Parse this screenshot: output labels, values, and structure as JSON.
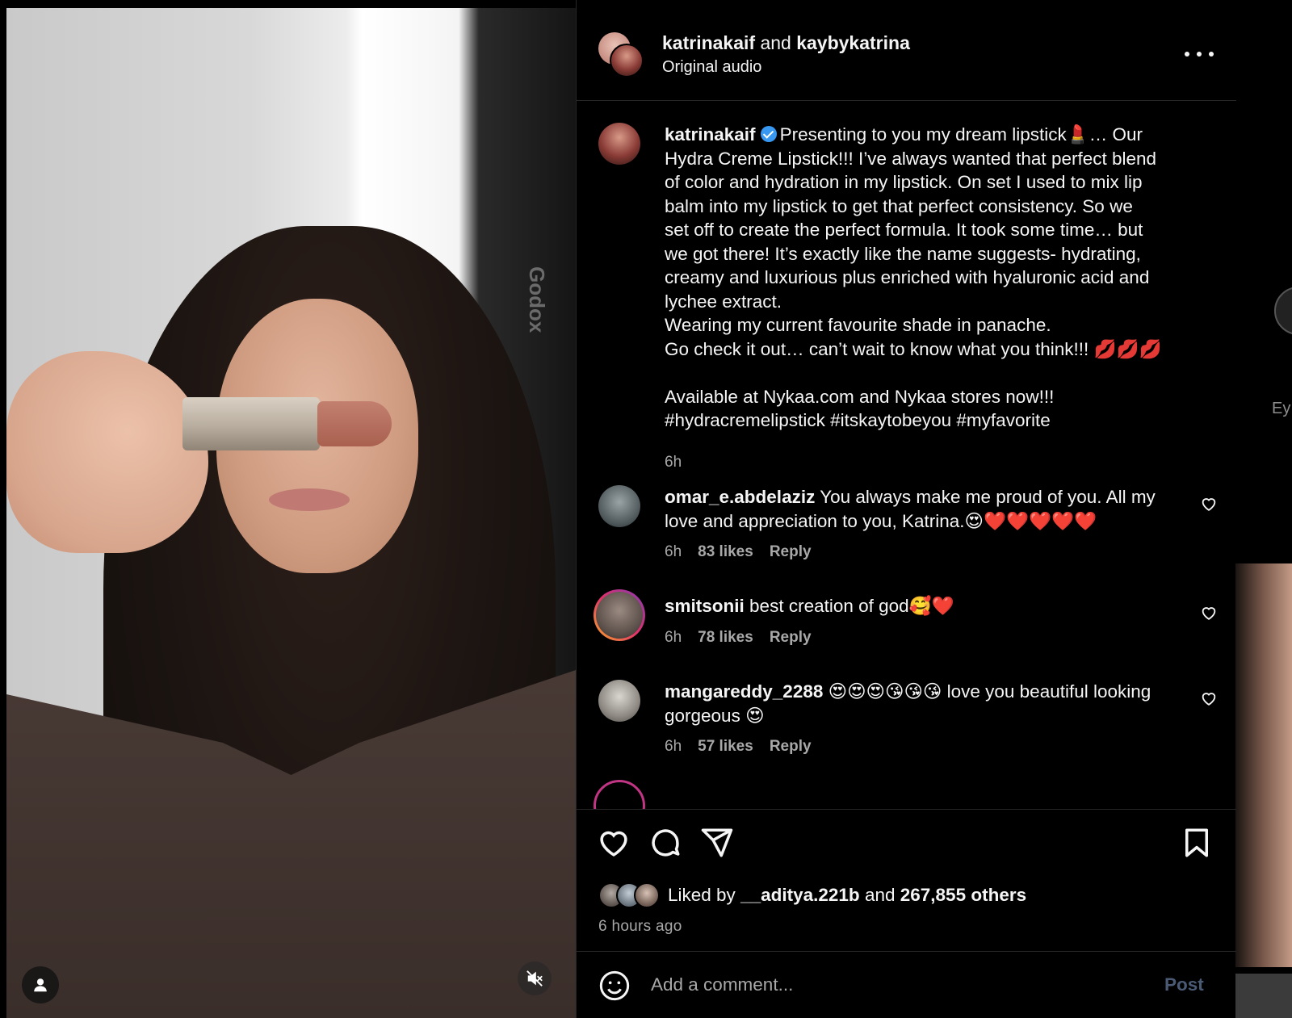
{
  "video": {
    "softbox_brand": "Godox"
  },
  "header": {
    "author": "katrinakaif",
    "connector": "and",
    "coauthor": "kaybykatrina",
    "audio": "Original audio"
  },
  "caption": {
    "username": "katrinakaif",
    "lines": [
      "Presenting to you my dream lipstick💄… Our",
      "Hydra Creme Lipstick!!! I’ve always wanted that perfect blend",
      "of color and hydration in my lipstick. On set I used to mix lip",
      "balm into my lipstick to get that perfect consistency. So we",
      "set off to create the perfect formula. It took some time… but",
      "we got there! It’s exactly like the name suggests- hydrating,",
      "creamy and luxurious plus enriched with hyaluronic acid and",
      "lychee extract.",
      "Wearing my current favourite shade in panache.",
      "Go check it out… can’t wait to know what you think!!! 💋💋💋",
      "",
      "Available at Nykaa.com and Nykaa stores now!!!",
      "#hydracremelipstick #itskaytobeyou #myfavorite"
    ],
    "time": "6h"
  },
  "comments": [
    {
      "username": "omar_e.abdelaziz",
      "lines": [
        "You always make me proud of you. All my",
        "love and appreciation to you, Katrina.😍❤️❤️❤️❤️❤️"
      ],
      "time": "6h",
      "likes": "83 likes",
      "reply": "Reply"
    },
    {
      "username": "smitsonii",
      "lines": [
        "best creation of god🥰❤️"
      ],
      "time": "6h",
      "likes": "78 likes",
      "reply": "Reply"
    },
    {
      "username": "mangareddy_2288",
      "lines": [
        "😍😍😍😘😘😘 love you beautiful looking",
        "gorgeous 😍"
      ],
      "time": "6h",
      "likes": "57 likes",
      "reply": "Reply"
    }
  ],
  "likes": {
    "prefix": "Liked by",
    "user": "__aditya.221b",
    "connector": "and",
    "others": "267,855 others",
    "time_ago": "6 hours ago"
  },
  "add_comment": {
    "placeholder": "Add a comment...",
    "post_label": "Post"
  },
  "peek": {
    "text": "Ey"
  }
}
